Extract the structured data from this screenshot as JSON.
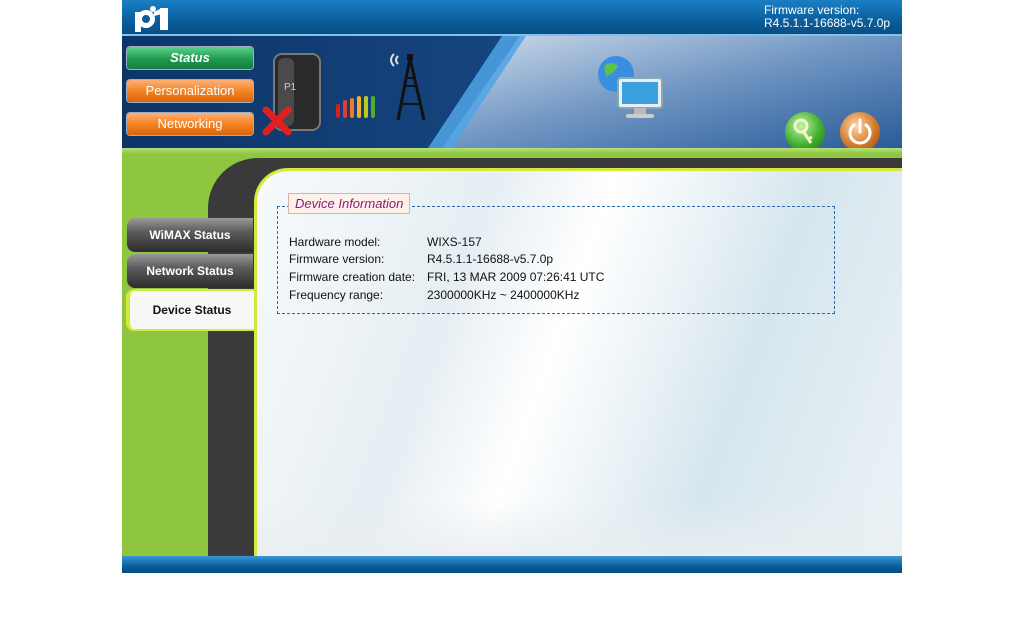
{
  "header": {
    "firmware_label": "Firmware version:",
    "firmware_value": "R4.5.1.1-16688-v5.7.0p"
  },
  "nav": {
    "status": "Status",
    "personalization": "Personalization",
    "networking": "Networking"
  },
  "sidebar": {
    "items": [
      {
        "label": "WiMAX Status"
      },
      {
        "label": "Network Status"
      },
      {
        "label": "Device Status"
      }
    ]
  },
  "device_info": {
    "title": "Device Information",
    "rows": [
      {
        "key": "Hardware model:",
        "value": "WIXS-157"
      },
      {
        "key": "Firmware version:",
        "value": "R4.5.1.1-16688-v5.7.0p"
      },
      {
        "key": "Firmware creation date:",
        "value": "FRI, 13 MAR 2009 07:26:41 UTC"
      },
      {
        "key": "Frequency range:",
        "value": "2300000KHz ~ 2400000KHz"
      }
    ]
  },
  "icons": {
    "logo": "p1-logo",
    "device": "modem-device-icon",
    "signal": "signal-bars-icon",
    "tower": "antenna-tower-icon",
    "computer": "globe-computer-icon",
    "settings": "key-settings-icon",
    "power": "power-icon"
  },
  "colors": {
    "top_bar": "#0a5d9a",
    "status_button": "#1e9a50",
    "orange_button": "#f3801f",
    "green_background": "#8ec63f",
    "legend_text": "#8b1a7a"
  }
}
